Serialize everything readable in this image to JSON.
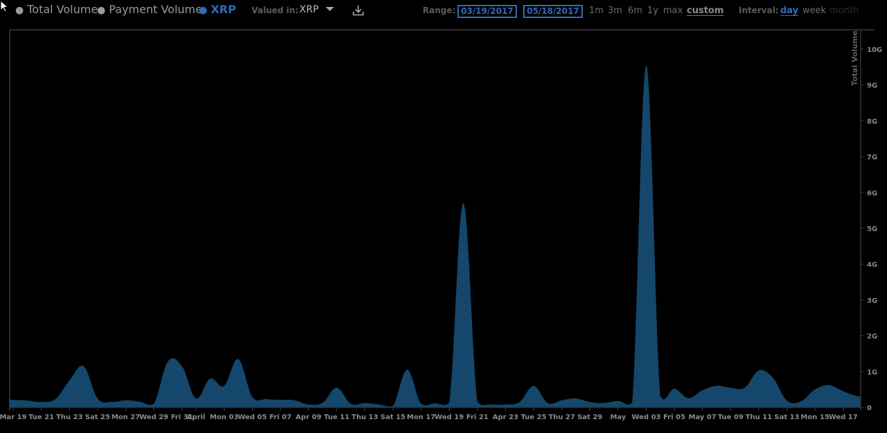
{
  "header": {
    "series": [
      {
        "label": "Total Volume",
        "active": false
      },
      {
        "label": "Payment Volume",
        "active": false
      },
      {
        "label": "XRP",
        "active": true
      }
    ],
    "valued_in_label": "Valued in:",
    "valued_in_value": "XRP",
    "range_label": "Range:",
    "start_date": "03/19/2017",
    "end_date": "05/18/2017",
    "range_options": [
      "1m",
      "3m",
      "6m",
      "1y",
      "max",
      "custom"
    ],
    "range_selected": "custom",
    "interval_label": "Interval:",
    "interval_options": [
      "day",
      "week",
      "month"
    ],
    "interval_selected": "day",
    "interval_disabled": "month"
  },
  "colors": {
    "accent": "#2e6db4",
    "area_fill": "#14476b",
    "axis": "#333333"
  },
  "chart_data": {
    "type": "area",
    "title": "",
    "xlabel": "",
    "ylabel": "Total Volume",
    "y_unit": "G",
    "ylim": [
      0,
      10.3
    ],
    "y_ticks": [
      0,
      1,
      2,
      3,
      4,
      5,
      6,
      7,
      8,
      9,
      10
    ],
    "y_tick_labels": [
      "0",
      "1G",
      "2G",
      "3G",
      "4G",
      "5G",
      "6G",
      "7G",
      "8G",
      "9G",
      "10G"
    ],
    "x_start": "2017-03-19",
    "x_end": "2017-05-18",
    "x_tick_labels": [
      {
        "day": 0,
        "label": "Mar 19"
      },
      {
        "day": 2,
        "label": "Tue 21"
      },
      {
        "day": 4,
        "label": "Thu 23"
      },
      {
        "day": 6,
        "label": "Sat 25"
      },
      {
        "day": 8,
        "label": "Mon 27"
      },
      {
        "day": 10,
        "label": "Wed 29"
      },
      {
        "day": 12,
        "label": "Fri 31"
      },
      {
        "day": 13,
        "label": "April"
      },
      {
        "day": 15,
        "label": "Mon 03"
      },
      {
        "day": 17,
        "label": "Wed 05"
      },
      {
        "day": 19,
        "label": "Fri 07"
      },
      {
        "day": 21,
        "label": "Apr 09"
      },
      {
        "day": 23,
        "label": "Tue 11"
      },
      {
        "day": 25,
        "label": "Thu 13"
      },
      {
        "day": 27,
        "label": "Sat 15"
      },
      {
        "day": 29,
        "label": "Mon 17"
      },
      {
        "day": 31,
        "label": "Wed 19"
      },
      {
        "day": 33,
        "label": "Fri 21"
      },
      {
        "day": 35,
        "label": "Apr 23"
      },
      {
        "day": 37,
        "label": "Tue 25"
      },
      {
        "day": 39,
        "label": "Thu 27"
      },
      {
        "day": 41,
        "label": "Sat 29"
      },
      {
        "day": 43,
        "label": "May"
      },
      {
        "day": 45,
        "label": "Wed 03"
      },
      {
        "day": 47,
        "label": "Fri 05"
      },
      {
        "day": 49,
        "label": "May 07"
      },
      {
        "day": 51,
        "label": "Tue 09"
      },
      {
        "day": 53,
        "label": "Thu 11"
      },
      {
        "day": 55,
        "label": "Sat 13"
      },
      {
        "day": 57,
        "label": "Mon 15"
      },
      {
        "day": 59,
        "label": "Wed 17"
      }
    ],
    "series": [
      {
        "name": "Total Volume (XRP)",
        "values": [
          0.21,
          0.19,
          0.15,
          0.23,
          0.75,
          1.15,
          0.25,
          0.15,
          0.2,
          0.16,
          0.1,
          1.28,
          1.15,
          0.25,
          0.8,
          0.6,
          1.35,
          0.3,
          0.23,
          0.21,
          0.2,
          0.08,
          0.13,
          0.55,
          0.1,
          0.12,
          0.08,
          0.04,
          1.05,
          0.1,
          0.11,
          0.12,
          5.7,
          0.15,
          0.08,
          0.08,
          0.15,
          0.6,
          0.12,
          0.2,
          0.25,
          0.15,
          0.12,
          0.18,
          0.12,
          9.55,
          0.33,
          0.52,
          0.26,
          0.48,
          0.6,
          0.55,
          0.55,
          1.03,
          0.83,
          0.19,
          0.17,
          0.5,
          0.62,
          0.45,
          0.31
        ]
      }
    ],
    "grid": false,
    "legend": "none"
  }
}
